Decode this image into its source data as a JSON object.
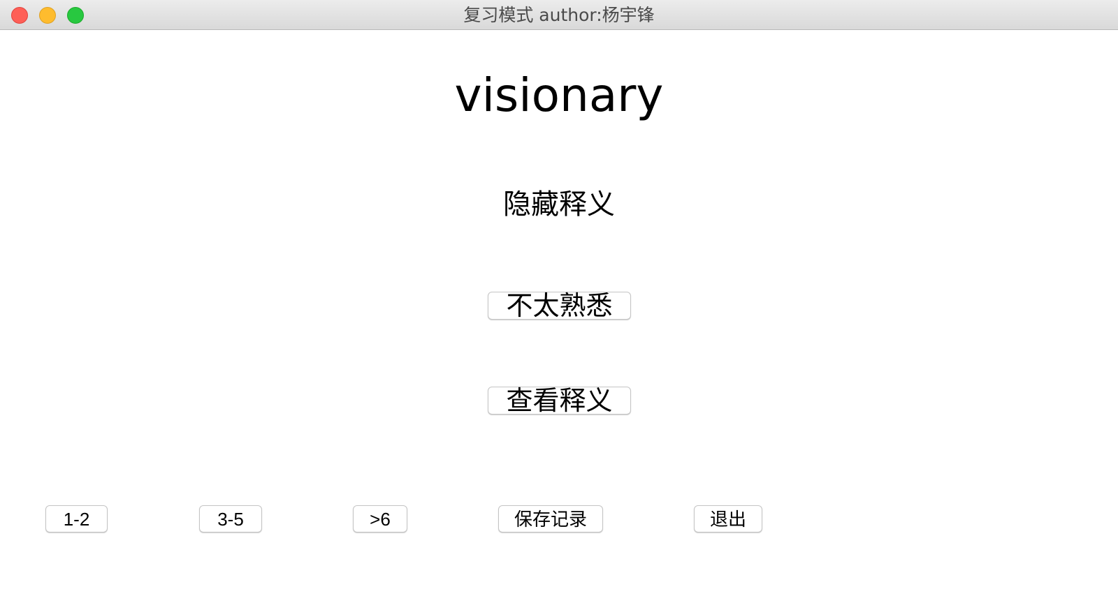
{
  "window": {
    "title": "复习模式 author:杨宇锋"
  },
  "main": {
    "word": "visionary",
    "definition_status": "隐藏释义",
    "unfamiliar_button": "不太熟悉",
    "view_definition_button": "查看释义"
  },
  "footer": {
    "buttons": [
      {
        "label": "1-2"
      },
      {
        "label": "3-5"
      },
      {
        "label": ">6"
      },
      {
        "label": "保存记录"
      },
      {
        "label": "退出"
      }
    ]
  },
  "colors": {
    "close": "#fe5f57",
    "minimize": "#febc2e",
    "maximize": "#28c840"
  }
}
